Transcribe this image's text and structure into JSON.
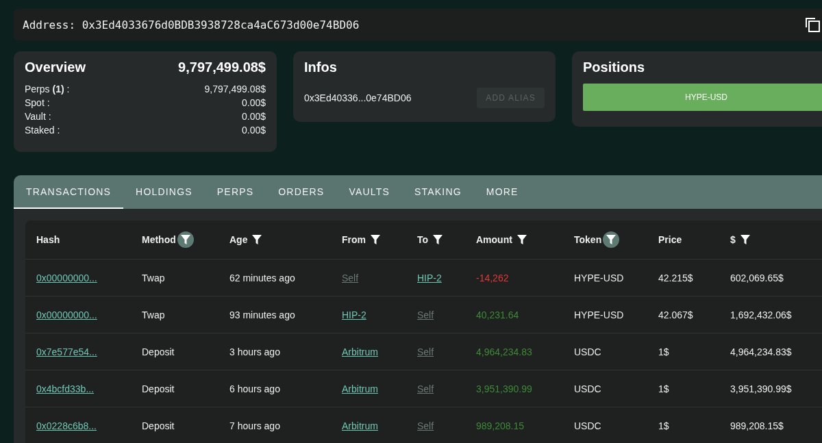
{
  "address_bar": {
    "label": "Address:",
    "value": "0x3Ed4033676d0BDB3938728ca4aC673d00e74BD06"
  },
  "overview": {
    "title": "Overview",
    "total": "9,797,499.08$",
    "rows": [
      {
        "label": "Perps **(1)** :",
        "value": "9,797,499.08$"
      },
      {
        "label": "Spot :",
        "value": "0.00$"
      },
      {
        "label": "Vault :",
        "value": "0.00$"
      },
      {
        "label": "Staked :",
        "value": "0.00$"
      }
    ]
  },
  "infos": {
    "title": "Infos",
    "short_address": "0x3Ed40336...0e74BD06",
    "alias_button": {
      "label": "ADD ALIAS",
      "disabled": true
    }
  },
  "positions": {
    "title": "Positions",
    "items": [
      "HYPE-USD"
    ]
  },
  "tabs": [
    {
      "label": "TRANSACTIONS",
      "selected": true
    },
    {
      "label": "HOLDINGS",
      "selected": false
    },
    {
      "label": "PERPS",
      "selected": false
    },
    {
      "label": "ORDERS",
      "selected": false
    },
    {
      "label": "VAULTS",
      "selected": false
    },
    {
      "label": "STAKING",
      "selected": false
    },
    {
      "label": "MORE",
      "selected": false
    }
  ],
  "table": {
    "columns": [
      {
        "label": "Hash",
        "filter": false
      },
      {
        "label": "Method",
        "filter": true,
        "filter_active": true
      },
      {
        "label": "Age",
        "filter": true,
        "filter_active": false
      },
      {
        "label": "From",
        "filter": true,
        "filter_active": false
      },
      {
        "label": "To",
        "filter": true,
        "filter_active": false
      },
      {
        "label": "Amount",
        "filter": true,
        "filter_active": false
      },
      {
        "label": "Token",
        "filter": true,
        "filter_active": true
      },
      {
        "label": "Price",
        "filter": false
      },
      {
        "label": "$",
        "filter": true,
        "filter_active": false
      }
    ],
    "rows": [
      {
        "hash": "0x00000000...",
        "method": "Twap",
        "age": "62 minutes ago",
        "from": {
          "text": "Self",
          "muted": true
        },
        "to": {
          "text": "HIP-2",
          "muted": false
        },
        "amount": "-14,262",
        "color": "#e53935",
        "token": "HYPE-USD",
        "price": "42.215$",
        "usd": "602,069.65$"
      },
      {
        "hash": "0x00000000...",
        "method": "Twap",
        "age": "93 minutes ago",
        "from": {
          "text": "HIP-2",
          "muted": false
        },
        "to": {
          "text": "Self",
          "muted": true
        },
        "amount": "40,231.64",
        "color": "#3d8b37",
        "token": "HYPE-USD",
        "price": "42.067$",
        "usd": "1,692,432.06$"
      },
      {
        "hash": "0x7e577e54...",
        "method": "Deposit",
        "age": "3 hours ago",
        "from": {
          "text": "Arbitrum",
          "muted": false
        },
        "to": {
          "text": "Self",
          "muted": true
        },
        "amount": "4,964,234.83",
        "color": "#3d8b37",
        "token": "USDC",
        "price": "1$",
        "usd": "4,964,234.83$"
      },
      {
        "hash": "0x4bcfd33b...",
        "method": "Deposit",
        "age": "6 hours ago",
        "from": {
          "text": "Arbitrum",
          "muted": false
        },
        "to": {
          "text": "Self",
          "muted": true
        },
        "amount": "3,951,390.99",
        "color": "#3d8b37",
        "token": "USDC",
        "price": "1$",
        "usd": "3,951,390.99$"
      },
      {
        "hash": "0x0228c6b8...",
        "method": "Deposit",
        "age": "7 hours ago",
        "from": {
          "text": "Arbitrum",
          "muted": false
        },
        "to": {
          "text": "Self",
          "muted": true
        },
        "amount": "989,208.15",
        "color": "#3d8b37",
        "token": "USDC",
        "price": "1$",
        "usd": "989,208.15$"
      }
    ]
  }
}
